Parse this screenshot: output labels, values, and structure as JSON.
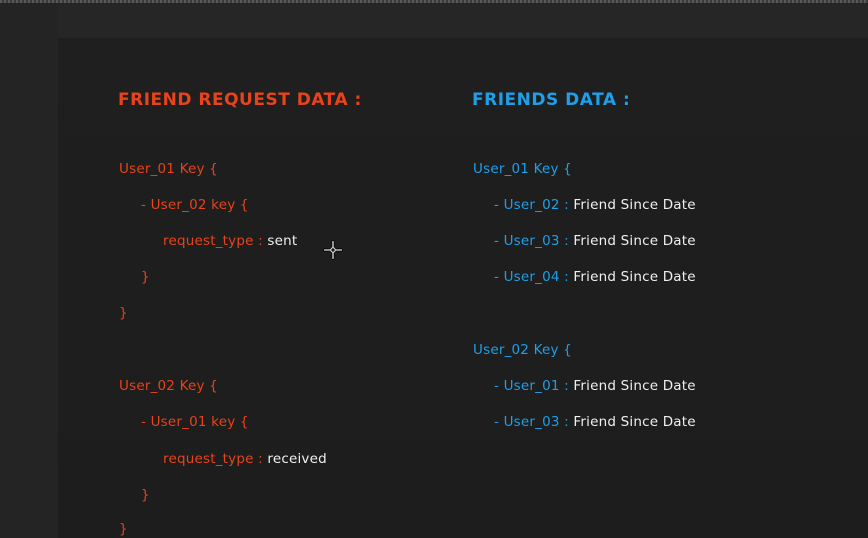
{
  "left": {
    "title": "FRIEND REQUEST DATA :",
    "user1_key": "User_01 Key {",
    "user1_inner_key": "- User_02 key {",
    "user1_request_label": "request_type",
    "user1_colon": " : ",
    "user1_request_value": "sent",
    "user1_inner_close": "}",
    "user1_close": "}",
    "user2_key": "User_02 Key {",
    "user2_inner_key": "- User_01 key {",
    "user2_request_label": "request_type",
    "user2_colon": " : ",
    "user2_request_value": "received",
    "user2_inner_close": "}",
    "user2_close": "}"
  },
  "right": {
    "title": "FRIENDS DATA :",
    "group1_key": "User_01 Key {",
    "group1_items": [
      {
        "user": "- User_02",
        "colon": " : ",
        "value": "Friend Since Date"
      },
      {
        "user": "- User_03",
        "colon": " : ",
        "value": "Friend Since Date"
      },
      {
        "user": "- User_04",
        "colon": " : ",
        "value": "Friend Since Date"
      }
    ],
    "group2_key": "User_02 Key {",
    "group2_items": [
      {
        "user": "- User_01",
        "colon": " : ",
        "value": "Friend Since Date"
      },
      {
        "user": "- User_03",
        "colon": " : ",
        "value": "Friend Since Date"
      }
    ]
  },
  "colors": {
    "orange": "#e8431a",
    "blue": "#1e9fe8",
    "white": "#f0f0f0",
    "background": "#1f1f1f"
  },
  "icons": {
    "cursor": "crosshair-move-cursor-icon"
  }
}
